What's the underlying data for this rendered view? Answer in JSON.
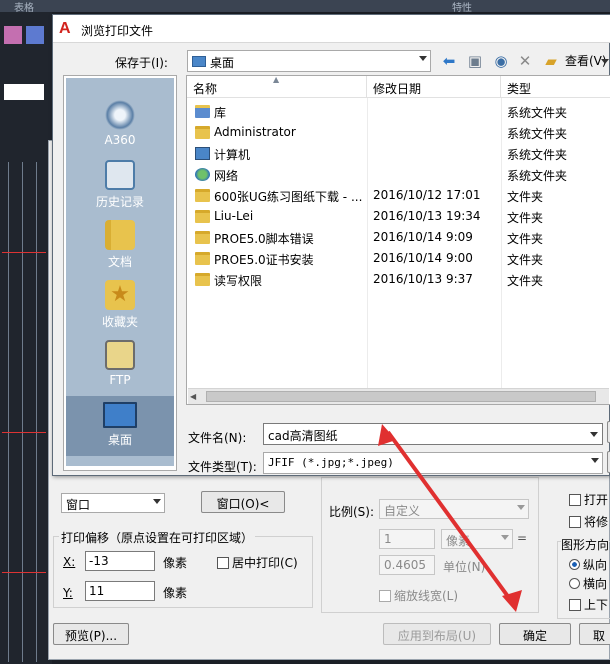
{
  "background": {
    "top_labels": [
      "表格",
      "特性"
    ]
  },
  "dialog": {
    "title": "浏览打印文件",
    "app_icon_letter": "A",
    "save_in_label": "保存于(I):",
    "save_in_value": "桌面",
    "view_label": "查看(V)",
    "places": [
      {
        "label": "A360",
        "icon": "a360-icon"
      },
      {
        "label": "历史记录",
        "icon": "history-icon"
      },
      {
        "label": "文档",
        "icon": "documents-icon"
      },
      {
        "label": "收藏夹",
        "icon": "favorites-icon"
      },
      {
        "label": "FTP",
        "icon": "ftp-icon"
      },
      {
        "label": "桌面",
        "icon": "desktop-icon"
      }
    ],
    "columns": [
      "名称",
      "修改日期",
      "类型"
    ],
    "files": [
      {
        "name": "库",
        "date": "",
        "type": "系统文件夹",
        "icon": "library-icon"
      },
      {
        "name": "Administrator",
        "date": "",
        "type": "系统文件夹",
        "icon": "user-folder-icon"
      },
      {
        "name": "计算机",
        "date": "",
        "type": "系统文件夹",
        "icon": "computer-icon"
      },
      {
        "name": "网络",
        "date": "",
        "type": "系统文件夹",
        "icon": "network-icon"
      },
      {
        "name": "600张UG练习图纸下载 - ...",
        "date": "2016/10/12 17:01",
        "type": "文件夹",
        "icon": "folder-icon"
      },
      {
        "name": "Liu-Lei",
        "date": "2016/10/13 19:34",
        "type": "文件夹",
        "icon": "folder-icon"
      },
      {
        "name": "PROE5.0脚本错误",
        "date": "2016/10/14 9:09",
        "type": "文件夹",
        "icon": "folder-icon"
      },
      {
        "name": "PROE5.0证书安装",
        "date": "2016/10/14 9:00",
        "type": "文件夹",
        "icon": "folder-icon"
      },
      {
        "name": "读写权限",
        "date": "2016/10/13 9:37",
        "type": "文件夹",
        "icon": "folder-icon"
      }
    ],
    "filename_label": "文件名(N):",
    "filename_value": "cad高清图纸",
    "filetype_label": "文件类型(T):",
    "filetype_value": "JFIF (*.jpg;*.jpeg)"
  },
  "print_dialog": {
    "window_select": "窗口",
    "window_button": "窗口(O)<",
    "offset_title": "打印偏移（原点设置在可打印区域）",
    "x_label": "X:",
    "x_value": "-13",
    "y_label": "Y:",
    "y_value": "11",
    "unit_mm": "像素",
    "center_print": "居中打印(C)",
    "scale_label": "比例(S):",
    "scale_value": "自定义",
    "scale_num": "1",
    "scale_unit": "像素",
    "scale_den": "0.4605",
    "unit_label": "单位(N)",
    "lineweight": "缩放线宽(L)",
    "right_open": "打开",
    "right_save": "将修",
    "orientation_title": "图形方向",
    "portrait": "纵向",
    "landscape": "横向",
    "upside": "上下",
    "preview_button": "预览(P)...",
    "apply_button": "应用到布局(U)",
    "ok_button": "确定",
    "cancel_button": "取"
  },
  "colors": {
    "arrow": "#e03030",
    "places_bg": "#a9bccf",
    "folder": "#e8c34d"
  }
}
